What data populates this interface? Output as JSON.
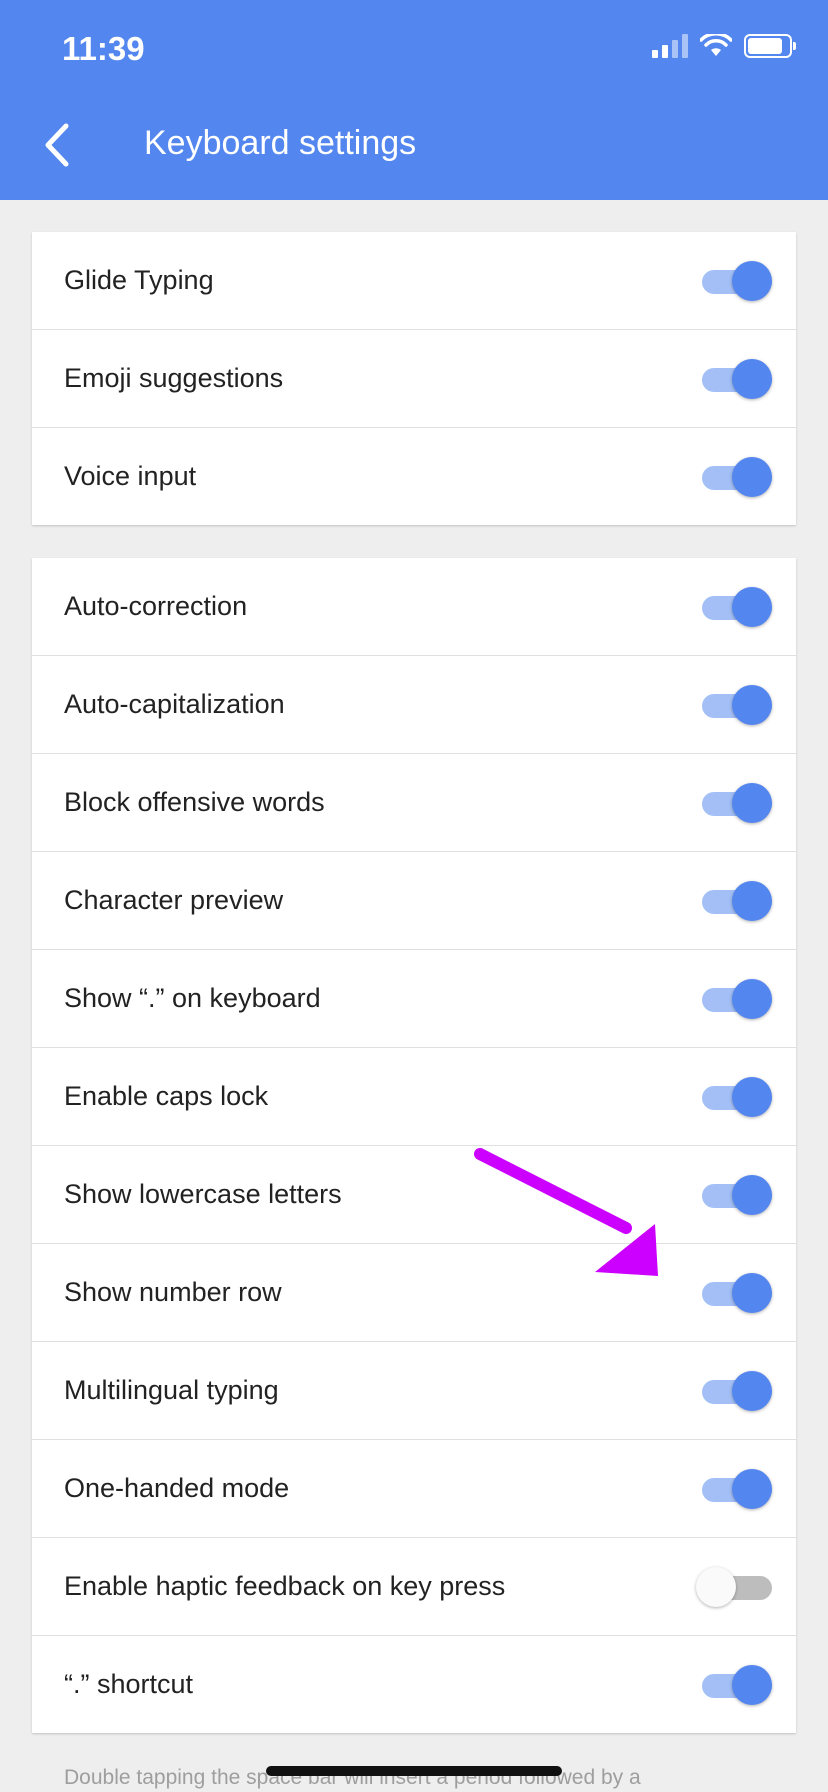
{
  "status_bar": {
    "time": "11:39"
  },
  "header": {
    "title": "Keyboard settings"
  },
  "group1": [
    {
      "label": "Glide Typing",
      "on": true
    },
    {
      "label": "Emoji suggestions",
      "on": true
    },
    {
      "label": "Voice input",
      "on": true
    }
  ],
  "group2": [
    {
      "label": "Auto-correction",
      "on": true
    },
    {
      "label": "Auto-capitalization",
      "on": true
    },
    {
      "label": "Block offensive words",
      "on": true
    },
    {
      "label": "Character preview",
      "on": true
    },
    {
      "label": "Show “.” on keyboard",
      "on": true
    },
    {
      "label": "Enable caps lock",
      "on": true
    },
    {
      "label": "Show lowercase letters",
      "on": true
    },
    {
      "label": "Show number row",
      "on": true
    },
    {
      "label": "Multilingual typing",
      "on": true
    },
    {
      "label": "One-handed mode",
      "on": true
    },
    {
      "label": "Enable haptic feedback on key press",
      "on": false
    },
    {
      "label": "“.” shortcut",
      "on": true
    }
  ],
  "footnote": "Double tapping the space bar will insert a period followed by a",
  "colors": {
    "accent": "#5386ee",
    "track_on": "#a3bff6",
    "arrow": "#cc00ff"
  }
}
